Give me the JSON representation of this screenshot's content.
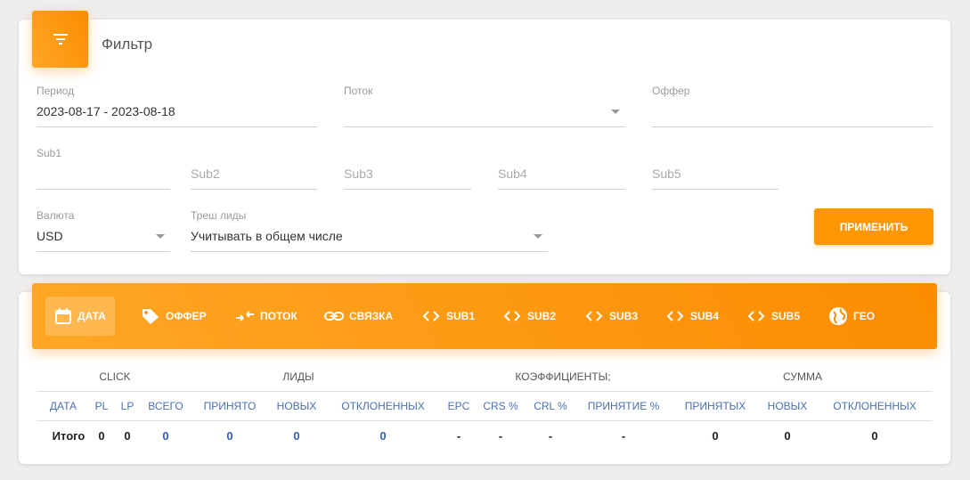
{
  "filter": {
    "title": "Фильтр",
    "icon": "filter-icon",
    "period": {
      "label": "Период",
      "value": "2023-08-17 - 2023-08-18"
    },
    "stream": {
      "label": "Поток",
      "value": ""
    },
    "offer": {
      "label": "Оффер",
      "value": ""
    },
    "sub1": {
      "label": "Sub1",
      "value": ""
    },
    "sub2": {
      "placeholder": "Sub2"
    },
    "sub3": {
      "placeholder": "Sub3"
    },
    "sub4": {
      "placeholder": "Sub4"
    },
    "sub5": {
      "placeholder": "Sub5"
    },
    "currency": {
      "label": "Валюта",
      "value": "USD"
    },
    "trash": {
      "label": "Треш лиды",
      "value": "Учитывать в общем числе"
    },
    "apply_label": "ПРИМЕНИТЬ"
  },
  "tabs": [
    {
      "label": "ДАТА",
      "icon": "calendar-icon",
      "active": true
    },
    {
      "label": "ОФФЕР",
      "icon": "tag-icon"
    },
    {
      "label": "ПОТОК",
      "icon": "merge-arrows-icon"
    },
    {
      "label": "СВЯЗКА",
      "icon": "link-icon"
    },
    {
      "label": "SUB1",
      "icon": "code-icon"
    },
    {
      "label": "SUB2",
      "icon": "code-icon"
    },
    {
      "label": "SUB3",
      "icon": "code-icon"
    },
    {
      "label": "SUB4",
      "icon": "code-icon"
    },
    {
      "label": "SUB5",
      "icon": "code-icon"
    },
    {
      "label": "ГЕО",
      "icon": "globe-icon"
    }
  ],
  "table": {
    "groups": [
      "CLICK",
      "ЛИДЫ",
      "КОЭФФИЦИЕНТЫ;",
      "СУММА"
    ],
    "columns": [
      "ДАТА",
      "PL",
      "LP",
      "ВСЕГО",
      "ПРИНЯТО",
      "НОВЫХ",
      "ОТКЛОНЕННЫХ",
      "EPC",
      "CRS %",
      "CRL %",
      "ПРИНЯТИЕ %",
      "ПРИНЯТЫХ",
      "НОВЫХ",
      "ОТКЛОНЕННЫХ"
    ],
    "total_row": [
      "Итого",
      "0",
      "0",
      "0",
      "0",
      "0",
      "0",
      "-",
      "-",
      "-",
      "-",
      "0",
      "0",
      "0"
    ]
  }
}
